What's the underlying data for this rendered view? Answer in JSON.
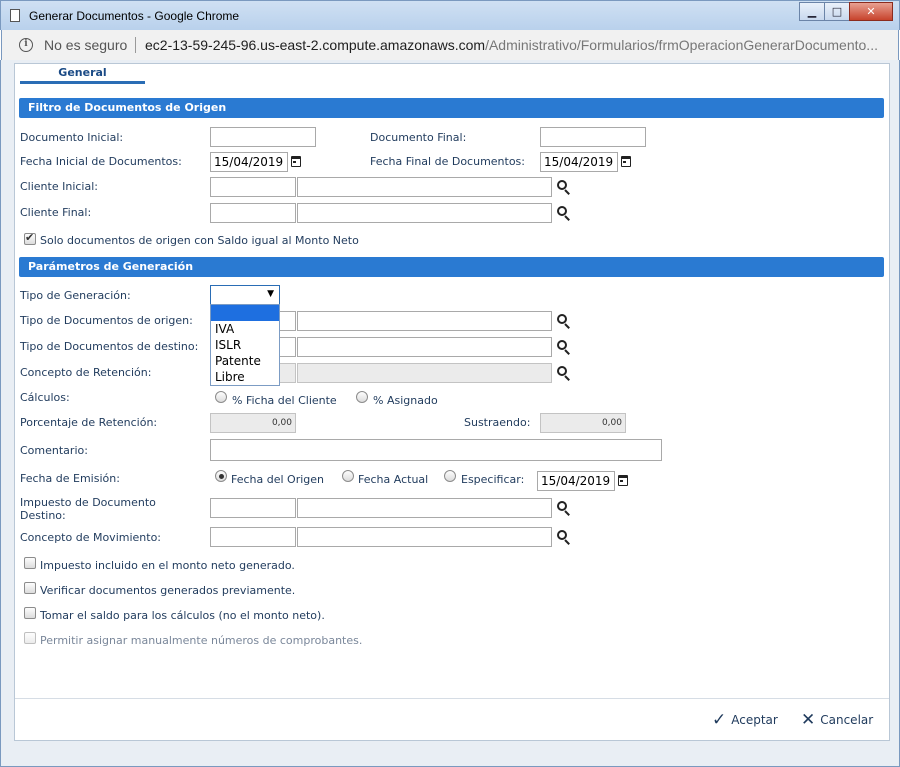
{
  "window": {
    "title": "Generar Documentos - Google Chrome",
    "minimize": "▁",
    "maximize": "□",
    "close": "✕"
  },
  "address_bar": {
    "security": "No es seguro",
    "host": "ec2-13-59-245-96.us-east-2.compute.amazonaws.com",
    "path": "/Administrativo/Formularios/frmOperacionGenerarDocumento..."
  },
  "tabs": [
    {
      "label": "General"
    }
  ],
  "filtro": {
    "header": "Filtro de Documentos de Origen",
    "documento_inicial_label": "Documento Inicial:",
    "documento_final_label": "Documento Final:",
    "fecha_inicial_label": "Fecha Inicial de Documentos:",
    "fecha_inicial_value": "15/04/2019",
    "fecha_final_label": "Fecha Final de Documentos:",
    "fecha_final_value": "15/04/2019",
    "cliente_inicial_label": "Cliente Inicial:",
    "cliente_final_label": "Cliente Final:",
    "solo_saldo_label": "Solo documentos de origen con Saldo igual al Monto Neto"
  },
  "parametros": {
    "header": "Parámetros de Generación",
    "tipo_generacion_label": "Tipo de Generación:",
    "tipo_generacion_options": [
      "",
      "IVA",
      "ISLR",
      "Patente",
      "Libre"
    ],
    "tipo_doc_origen_label": "Tipo de Documentos de origen:",
    "tipo_doc_destino_label": "Tipo de Documentos de destino:",
    "concepto_retencion_label": "Concepto de Retención:",
    "calculos_label": "Cálculos:",
    "calc_ficha_label": "% Ficha del Cliente",
    "calc_asignado_label": "% Asignado",
    "porcentaje_label": "Porcentaje de Retención:",
    "porcentaje_value": "0,00",
    "sustraendo_label": "Sustraendo:",
    "sustraendo_value": "0,00",
    "comentario_label": "Comentario:",
    "fecha_emision_label": "Fecha de Emisión:",
    "fecha_origen_label": "Fecha del Origen",
    "fecha_actual_label": "Fecha Actual",
    "especificar_label": "Especificar:",
    "especificar_value": "15/04/2019",
    "impuesto_label_1": "Impuesto de Documento",
    "impuesto_label_2": "Destino:",
    "concepto_mov_label": "Concepto de Movimiento:",
    "chk_impuesto_incluido": "Impuesto incluido en el monto neto generado.",
    "chk_verificar": "Verificar documentos generados previamente.",
    "chk_tomar_saldo": "Tomar el saldo para los cálculos (no el monto neto).",
    "chk_permitir": "Permitir asignar manualmente números de comprobantes."
  },
  "footer": {
    "aceptar": "Aceptar",
    "cancelar": "Cancelar"
  },
  "colors": {
    "section_header": "#2a7ad2",
    "label_text": "#1f3a5c",
    "dropdown_selected": "#1e6fe0"
  }
}
